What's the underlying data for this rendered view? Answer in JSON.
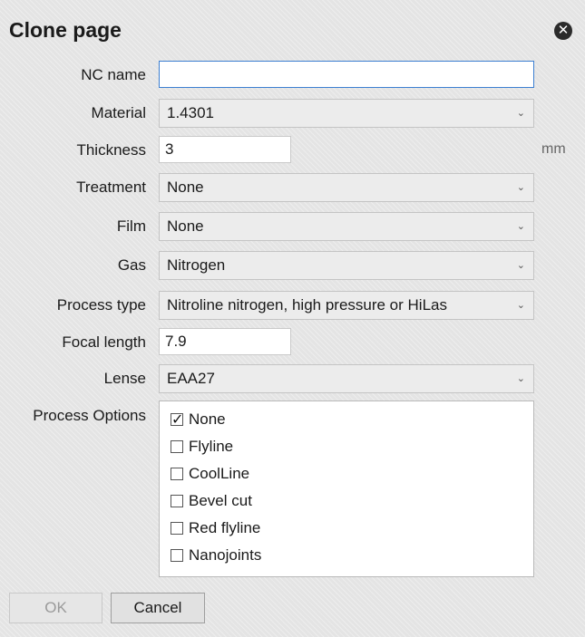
{
  "dialog": {
    "title": "Clone page",
    "close_icon": "close-icon"
  },
  "fields": {
    "nc_name": {
      "label": "NC name",
      "value": ""
    },
    "material": {
      "label": "Material",
      "value": "1.4301"
    },
    "thickness": {
      "label": "Thickness",
      "value": "3",
      "unit": "mm"
    },
    "treatment": {
      "label": "Treatment",
      "value": "None"
    },
    "film": {
      "label": "Film",
      "value": "None"
    },
    "gas": {
      "label": "Gas",
      "value": "Nitrogen"
    },
    "process_type": {
      "label": "Process type",
      "value": "Nitroline nitrogen, high pressure or HiLas"
    },
    "focal_length": {
      "label": "Focal length",
      "value": "7.9"
    },
    "lense": {
      "label": "Lense",
      "value": "EAA27"
    }
  },
  "process_options": {
    "label": "Process Options",
    "items": [
      {
        "label": "None",
        "checked": true
      },
      {
        "label": "Flyline",
        "checked": false
      },
      {
        "label": "CoolLine",
        "checked": false
      },
      {
        "label": "Bevel cut",
        "checked": false
      },
      {
        "label": "Red flyline",
        "checked": false
      },
      {
        "label": "Nanojoints",
        "checked": false
      }
    ]
  },
  "buttons": {
    "ok": "OK",
    "cancel": "Cancel"
  },
  "icons": {
    "dropdown": "chevron-down-icon",
    "checkbox_checked": "checkmark-icon"
  }
}
